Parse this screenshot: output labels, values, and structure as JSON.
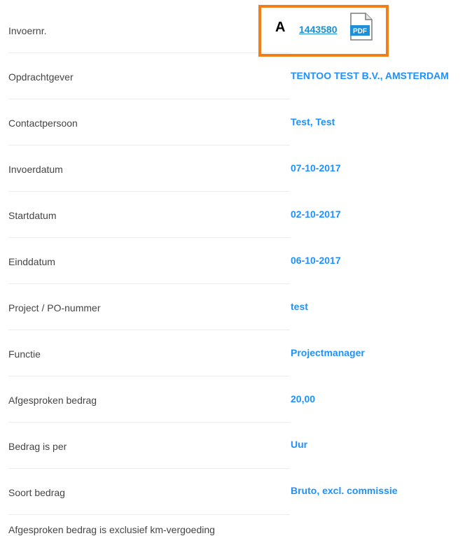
{
  "annotation": {
    "letter": "A",
    "color": "#f07f1a"
  },
  "invoice": {
    "number": "1443580",
    "pdf_label": "PDF",
    "icon": "pdf-icon"
  },
  "rows": [
    {
      "label": "Invoernr.",
      "value": ""
    },
    {
      "label": "Opdrachtgever",
      "value": "TENTOO TEST B.V., AMSTERDAM"
    },
    {
      "label": "Contactpersoon",
      "value": "Test, Test"
    },
    {
      "label": "Invoerdatum",
      "value": "07-10-2017"
    },
    {
      "label": "Startdatum",
      "value": "02-10-2017"
    },
    {
      "label": "Einddatum",
      "value": "06-10-2017"
    },
    {
      "label": "Project / PO-nummer",
      "value": "test"
    },
    {
      "label": "Functie",
      "value": "Projectmanager"
    },
    {
      "label": "Afgesproken bedrag",
      "value": "20,00"
    },
    {
      "label": "Bedrag is per",
      "value": "Uur"
    },
    {
      "label": "Soort bedrag",
      "value": "Bruto, excl. commissie"
    },
    {
      "label": "Afgesproken bedrag is exclusief km-vergoeding",
      "value": ""
    }
  ],
  "colors": {
    "value_text": "#1e90ff",
    "link": "#1a8fd6",
    "label_text": "#444444",
    "divider": "#ececec"
  }
}
